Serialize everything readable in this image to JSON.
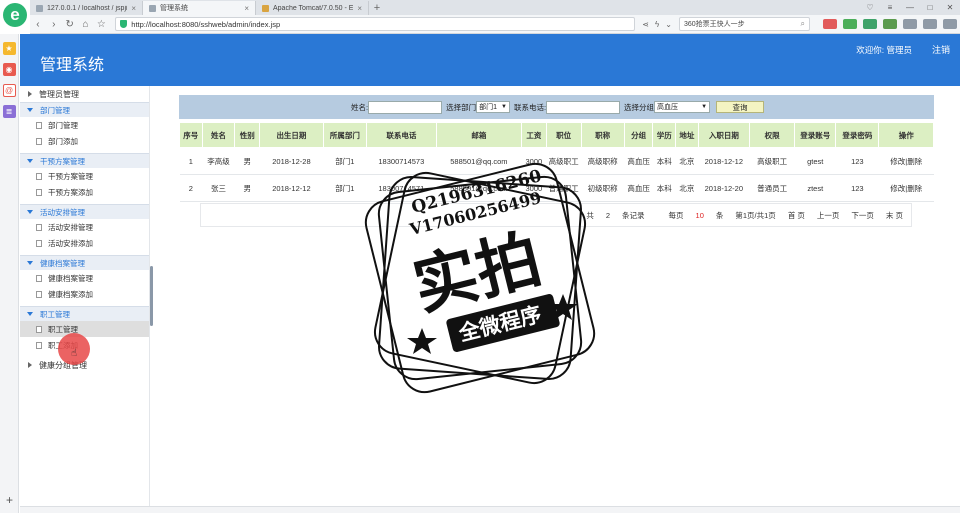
{
  "browser": {
    "tabs": [
      {
        "title": "127.0.0.1 / localhost / jspjian·",
        "active": false
      },
      {
        "title": "管理系统",
        "active": true
      },
      {
        "title": "Apache Tomcat/7.0.50 - Error",
        "active": false
      }
    ],
    "url": "http://localhost:8080/sshweb/admin/index.jsp",
    "search_text": "360抢票王快人一步",
    "logo_letter": "e",
    "new_tab": "+",
    "sidebar_plus": "+"
  },
  "header": {
    "title": "管理系统",
    "welcome": "欢迎你: 管理员",
    "logout": "注销",
    "color": "#2a78d6"
  },
  "menu": {
    "top": "管理员管理",
    "groups": [
      {
        "title": "部门管理",
        "items": [
          "部门管理",
          "部门添加"
        ]
      },
      {
        "title": "干预方案管理",
        "items": [
          "干预方案管理",
          "干预方案添加"
        ]
      },
      {
        "title": "活动安排管理",
        "items": [
          "活动安排管理",
          "活动安排添加"
        ]
      },
      {
        "title": "健康档案管理",
        "items": [
          "健康档案管理",
          "健康档案添加"
        ]
      },
      {
        "title": "职工管理",
        "items": [
          "职工管理",
          "职工添加"
        ]
      }
    ],
    "bottom": "健康分组管理"
  },
  "search": {
    "name_label": "姓名:",
    "dept_label": "选择部门",
    "dept_value": "部门1",
    "phone_label": "联系电话:",
    "group_label": "选择分组",
    "group_value": "高血压",
    "query_button": "查询"
  },
  "table": {
    "columns": [
      "序号",
      "姓名",
      "性别",
      "出生日期",
      "所属部门",
      "联系电话",
      "邮箱",
      "工资",
      "职位",
      "职称",
      "分组",
      "学历",
      "地址",
      "入职日期",
      "权限",
      "登录账号",
      "登录密码",
      "操作"
    ],
    "rows": [
      [
        "1",
        "李高级",
        "男",
        "2018-12-28",
        "部门1",
        "18300714573",
        "588501@qq.com",
        "3000",
        "高级职工",
        "高级职称",
        "高血压",
        "本科",
        "北京",
        "2018-12-12",
        "高级职工",
        "gtest",
        "123"
      ],
      [
        "2",
        "张三",
        "男",
        "2018-12-12",
        "部门1",
        "18300714571",
        "588501@qq.com",
        "3000",
        "普通职工",
        "初级职称",
        "高血压",
        "本科",
        "北京",
        "2018-12-20",
        "普通员工",
        "ztest",
        "123"
      ]
    ],
    "edit_label": "修改",
    "delete_label": "删除",
    "header_color": "#dcefc3"
  },
  "pager": {
    "total_prefix": "共",
    "total": "2",
    "total_suffix": "条记录",
    "per_page_prefix": "每页",
    "per_page": "10",
    "per_page_suffix": "条",
    "page_info": "第1页/共1页",
    "first": "首 页",
    "prev": "上一页",
    "next": "下一页",
    "last": "末 页"
  },
  "stamp": {
    "line1": "Q2196316260",
    "line2": "V17060256499",
    "big": "实拍",
    "banner": "全微程序"
  }
}
